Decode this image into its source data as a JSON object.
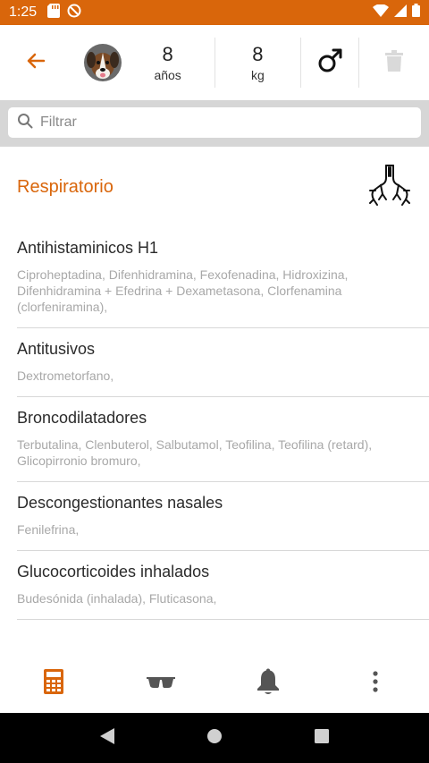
{
  "status_bar": {
    "time": "1:25",
    "color": "#d9660b"
  },
  "toolbar": {
    "back_icon": "arrow-left-icon",
    "avatar_icon": "dog-avatar",
    "age_value": "8",
    "age_unit": "años",
    "weight_value": "8",
    "weight_unit": "kg",
    "sex_icon": "male-symbol-icon",
    "delete_icon": "trash-icon"
  },
  "filter": {
    "placeholder": "Filtrar",
    "value": ""
  },
  "section": {
    "title": "Respiratorio",
    "icon": "lungs-icon",
    "accent": "#d9660b"
  },
  "items": [
    {
      "title": "Antihistaminicos H1",
      "description": "Ciproheptadina, Difenhidramina, Fexofenadina, Hidroxizina, Difenhidramina + Efedrina + Dexametasona, Clorfenamina (clorfeniramina),"
    },
    {
      "title": "Antitusivos",
      "description": "Dextrometorfano,"
    },
    {
      "title": "Broncodilatadores",
      "description": "Terbutalina, Clenbuterol, Salbutamol, Teofilina, Teofilina (retard), Glicopirronio bromuro,"
    },
    {
      "title": "Descongestionantes nasales",
      "description": "Fenilefrina,"
    },
    {
      "title": "Glucocorticoides inhalados",
      "description": "Budesónida (inhalada), Fluticasona,"
    }
  ],
  "bottom_nav": [
    {
      "icon": "calculator-icon",
      "active": true
    },
    {
      "icon": "glasses-icon",
      "active": false
    },
    {
      "icon": "bell-icon",
      "active": false
    },
    {
      "icon": "more-vert-icon",
      "active": false
    }
  ]
}
